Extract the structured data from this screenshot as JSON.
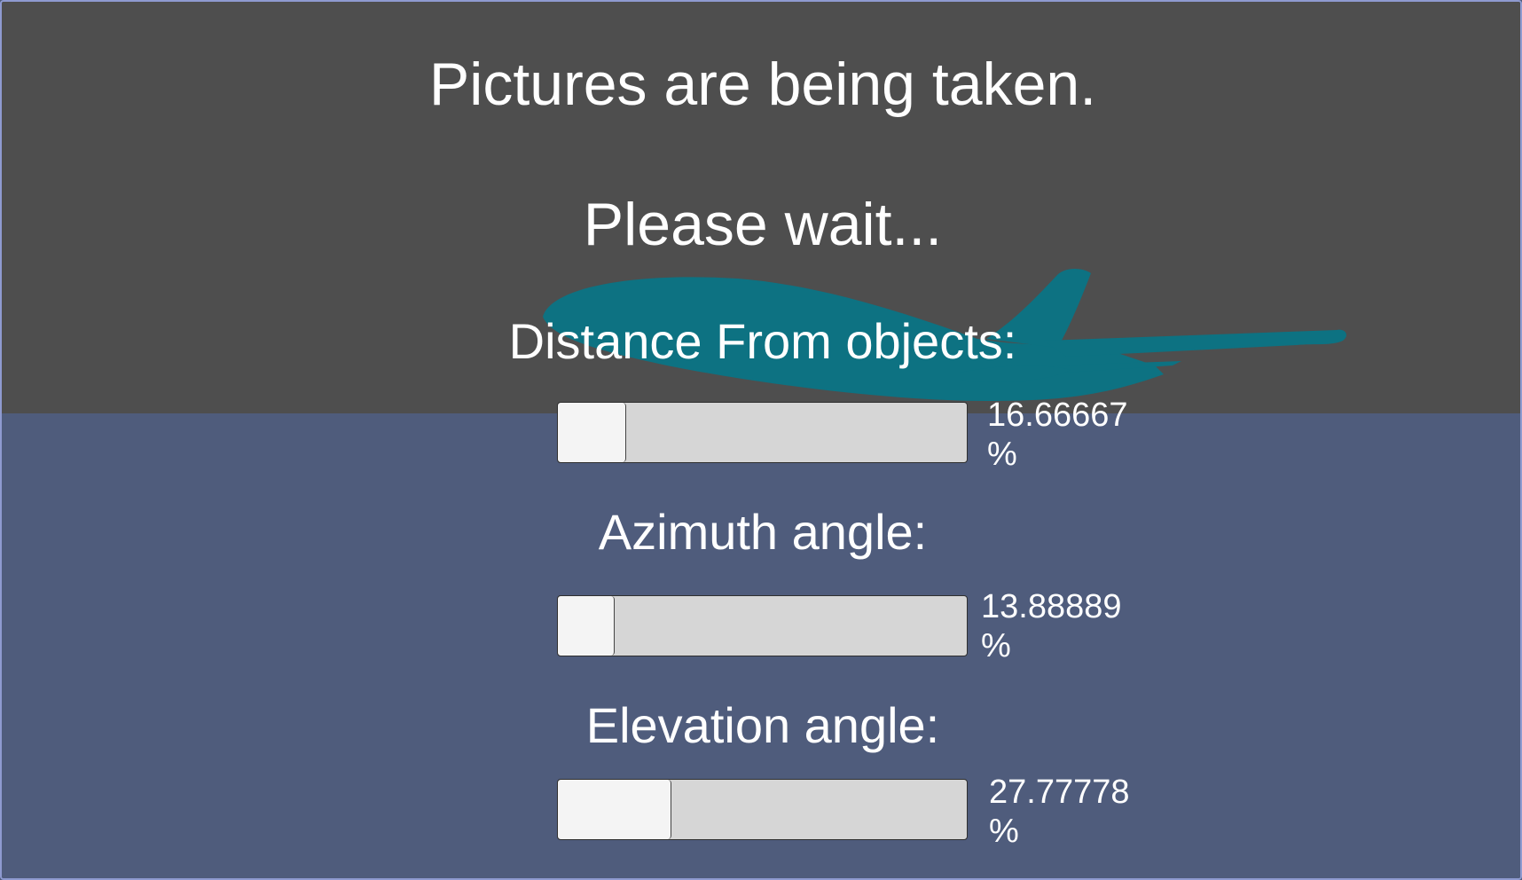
{
  "status": {
    "title": "Pictures are being taken.",
    "wait_text": "Please wait..."
  },
  "progress": [
    {
      "label": "Distance From objects:",
      "value_text": "16.66667",
      "unit": "%",
      "value": 16.66667
    },
    {
      "label": "Azimuth angle:",
      "value_text": "13.88889",
      "unit": "%",
      "value": 13.88889
    },
    {
      "label": "Elevation angle:",
      "value_text": "27.77778",
      "unit": "%",
      "value": 27.77778
    }
  ],
  "colors": {
    "sky": "#4e4e4e",
    "ground": "#4f5c7c",
    "airplane": "#0d7282",
    "bar_track": "#d6d6d6",
    "bar_fill": "#f4f4f4",
    "text": "#ffffff"
  },
  "icons": {
    "airplane": "airplane-silhouette"
  }
}
